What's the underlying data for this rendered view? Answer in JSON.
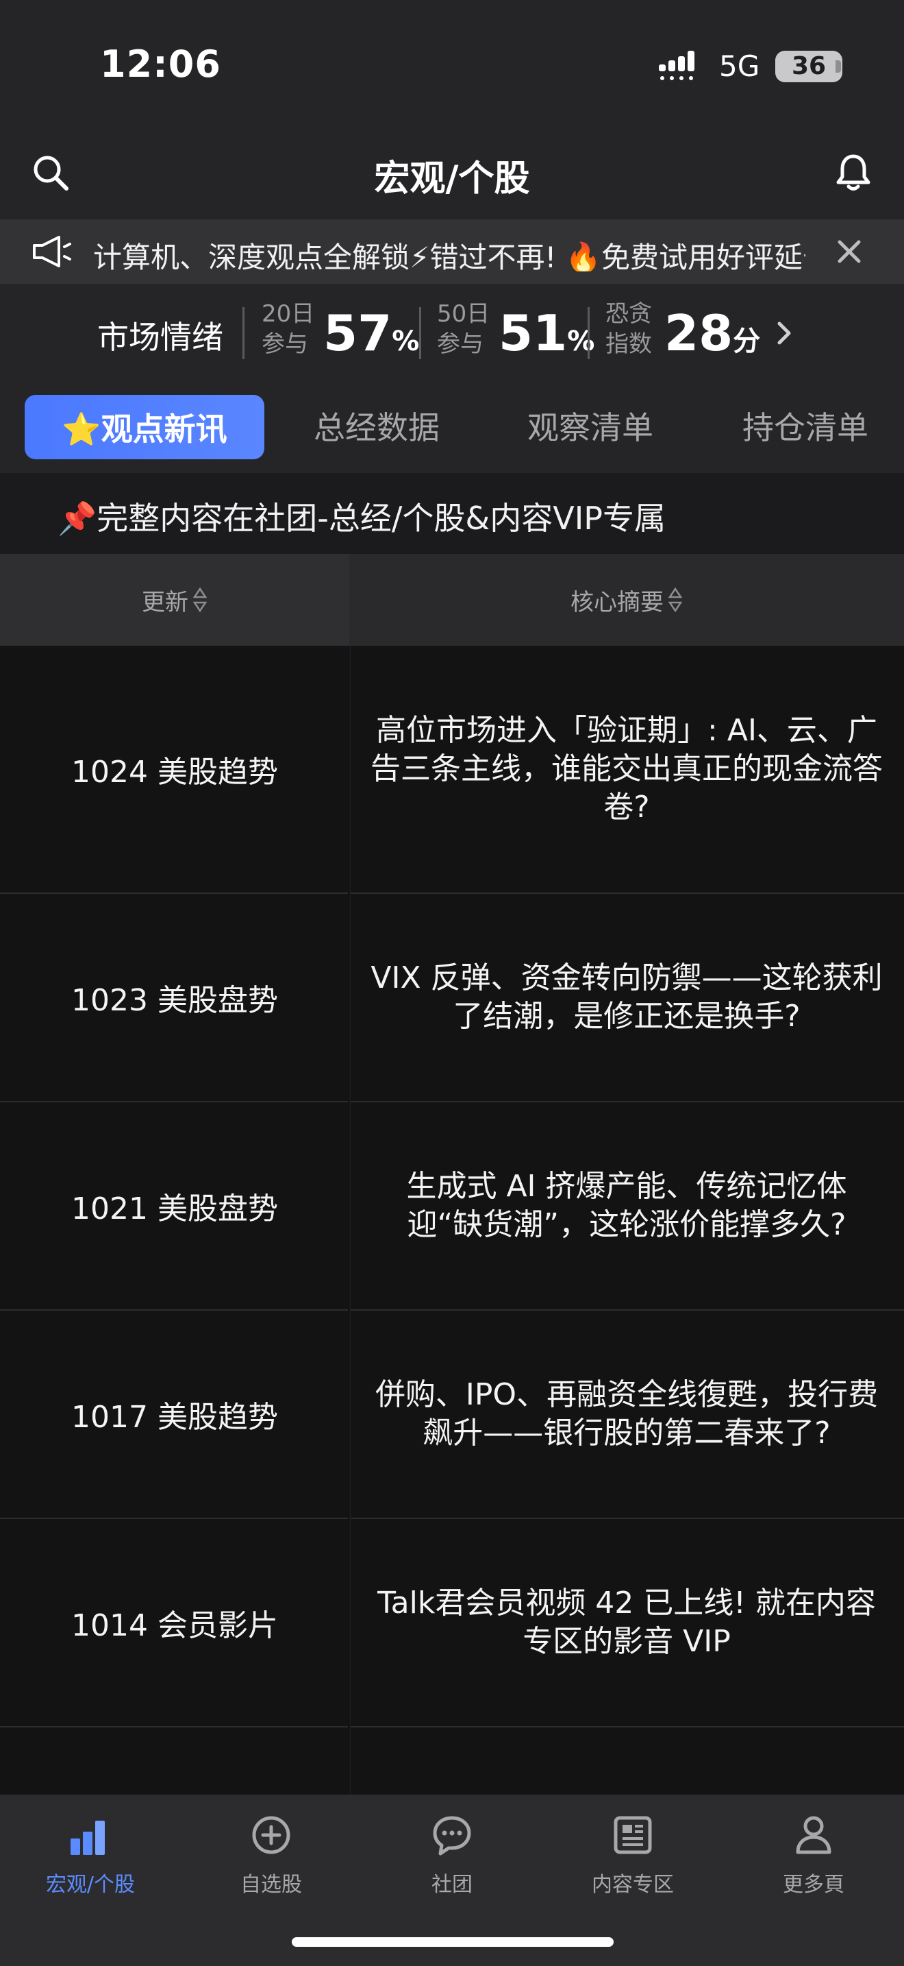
{
  "status_bar": {
    "time": "12:06",
    "network": "5G",
    "battery": "36"
  },
  "header": {
    "title": "宏观/个股",
    "search_icon": "search-icon",
    "bell_icon": "bell-icon"
  },
  "ticker": {
    "text": "计算机、深度观点全解锁⚡错过不再! 🔥免费试用好评延长"
  },
  "sentiment": {
    "title": "市场情绪",
    "day20_label_top": "20日",
    "day20_label_bottom": "参与",
    "day20_value": "57",
    "day20_unit": "%",
    "day50_label_top": "50日",
    "day50_label_bottom": "参与",
    "day50_value": "51",
    "day50_unit": "%",
    "fear_label_top": "恐贪",
    "fear_label_bottom": "指数",
    "fear_value": "28",
    "fear_unit": "分"
  },
  "tabs": [
    {
      "label": "⭐观点新讯",
      "active": true
    },
    {
      "label": "总经数据"
    },
    {
      "label": "观察清单"
    },
    {
      "label": "持仓清单"
    }
  ],
  "notice": {
    "text": "📌完整内容在社团-总经/个股&内容VIP专属"
  },
  "table": {
    "headers": [
      "更新",
      "核心摘要"
    ],
    "rows": [
      {
        "update": "1024 美股趋势",
        "summary": "高位市场进入「验证期」: AI、云、广告三条主线，谁能交出真正的现金流答卷?"
      },
      {
        "update": "1023 美股盘势",
        "summary": "VIX 反弹、资金转向防禦——这轮获利了结潮，是修正还是换手?"
      },
      {
        "update": "1021 美股盘势",
        "summary": "生成式 AI 挤爆产能、传统记忆体迎“缺货潮”，这轮涨价能撑多久?"
      },
      {
        "update": "1017 美股趋势",
        "summary": "併购、IPO、再融资全线復甦，投行费飙升——银行股的第二春来了?"
      },
      {
        "update": "1014 会员影片",
        "summary": "Talk君会员视频 42 已上线! 就在内容专区的影音 VIP"
      }
    ]
  },
  "bottom_nav": [
    {
      "label": "宏观/个股",
      "icon": "bar-chart-icon",
      "active": true
    },
    {
      "label": "自选股",
      "icon": "plus-circle-icon"
    },
    {
      "label": "社团",
      "icon": "chat-bubble-icon"
    },
    {
      "label": "内容专区",
      "icon": "newspaper-icon"
    },
    {
      "label": "更多頁",
      "icon": "user-icon"
    }
  ],
  "colors": {
    "accent": "#5b8cff",
    "background": "#252527",
    "table_bg": "#131314"
  }
}
